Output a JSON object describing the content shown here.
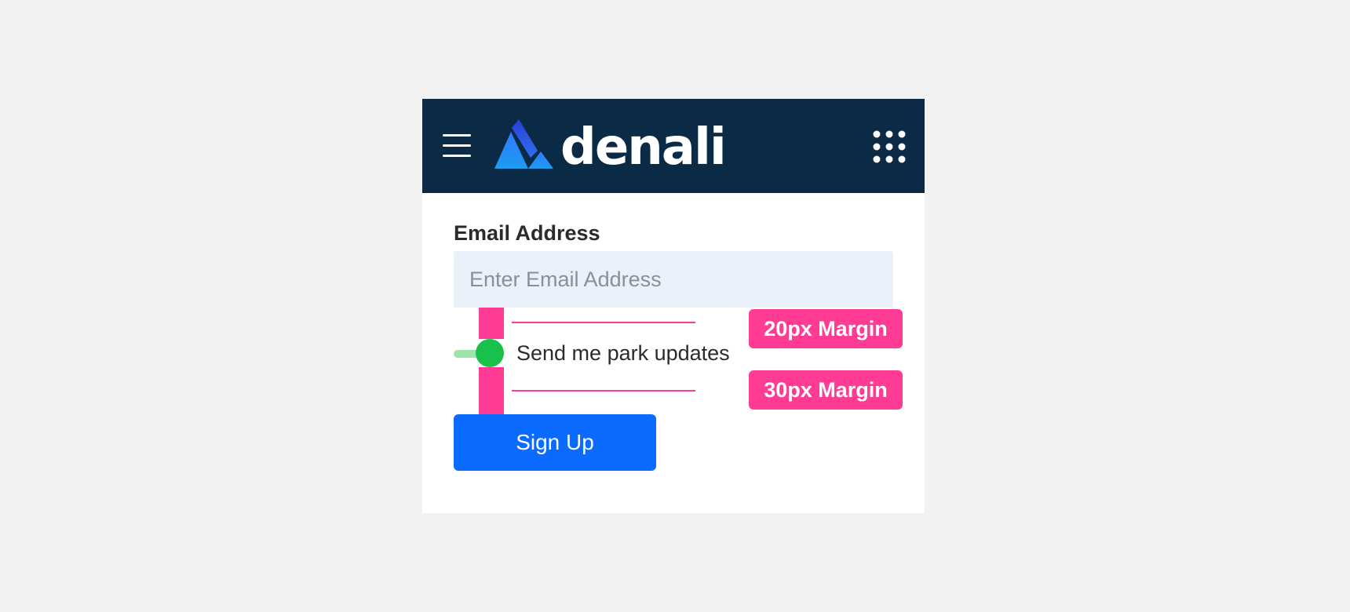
{
  "header": {
    "menu_icon": "hamburger-menu-icon",
    "brand": "denali",
    "apps_icon": "apps-grid-icon",
    "background": "#0b2a45"
  },
  "form": {
    "email_label": "Email Address",
    "email_placeholder": "Enter Email Address",
    "email_value": "",
    "toggle_label": "Send me park updates",
    "toggle_on": true,
    "toggle_color": "#17c14a",
    "submit_label": "Sign Up",
    "submit_color": "#0b6bff"
  },
  "annotations": {
    "top_margin_label": "20px Margin",
    "bottom_margin_label": "30px Margin",
    "annotation_color": "#ff3b93"
  }
}
